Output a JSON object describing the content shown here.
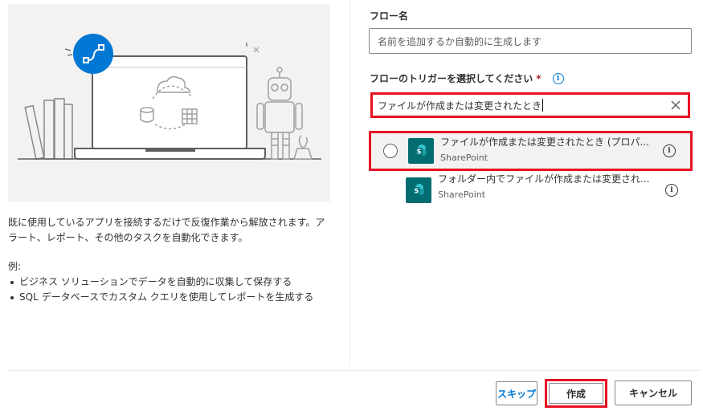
{
  "left_panel": {
    "description": "既に使用しているアプリを接続するだけで反復作業から解放されます。アラート、レポート、その他のタスクを自動化できます。",
    "examples_label": "例:",
    "examples": [
      "ビジネス ソリューションでデータを自動的に収集して保存する",
      "SQL データベースでカスタム クエリを使用してレポートを生成する"
    ]
  },
  "form": {
    "flow_name_label": "フロー名",
    "flow_name_placeholder": "名前を追加するか自動的に生成します",
    "trigger_label": "フローのトリガーを選択してください",
    "required_mark": "*",
    "info_glyph": "i",
    "search_value": "ファイルが作成または変更されたとき"
  },
  "triggers": [
    {
      "title": "ファイルが作成または変更されたとき (プロパ...",
      "connector": "SharePoint",
      "icon": "sharepoint-icon",
      "selected": true
    },
    {
      "title": "フォルダー内でファイルが作成または変更され...",
      "connector": "SharePoint",
      "icon": "sharepoint-icon",
      "selected": false
    }
  ],
  "buttons": {
    "skip": "スキップ",
    "create": "作成",
    "cancel": "キャンセル"
  },
  "colors": {
    "accent": "#0078d4",
    "highlight_border": "#e81123",
    "sharepoint": "#036c70",
    "illustration_bg": "#f3f2f1"
  }
}
